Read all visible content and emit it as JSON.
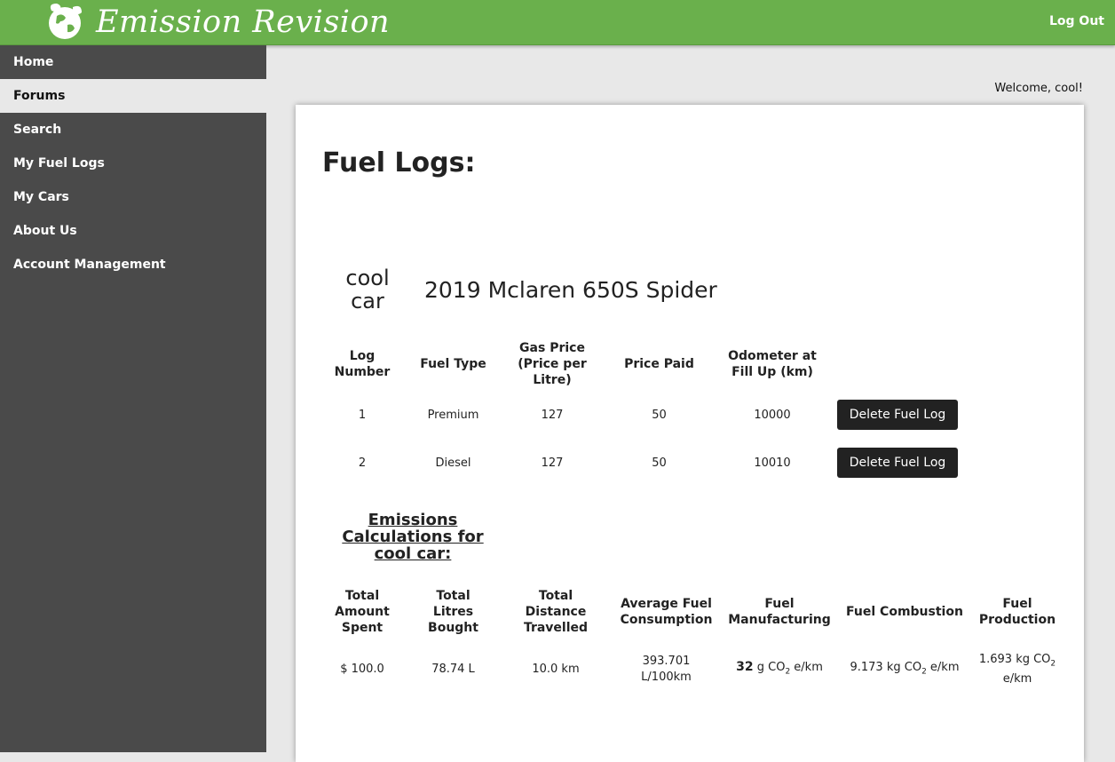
{
  "header": {
    "brand": "Emission Revision",
    "logo_icon": "leaf-globe-icon",
    "logout_label": "Log Out",
    "color": "#6ab04c"
  },
  "sidebar": {
    "items": [
      {
        "label": "Home",
        "active": false
      },
      {
        "label": "Forums",
        "active": true
      },
      {
        "label": "Search",
        "active": false
      },
      {
        "label": "My Fuel Logs",
        "active": false
      },
      {
        "label": "My Cars",
        "active": false
      },
      {
        "label": "About Us",
        "active": false
      },
      {
        "label": "Account Management",
        "active": false
      }
    ]
  },
  "welcome": "Welcome, cool!",
  "main": {
    "title": "Fuel Logs:",
    "car": {
      "nickname": "cool car",
      "name": "2019 Mclaren 650S Spider"
    },
    "logs_table": {
      "headers": [
        "Log Number",
        "Fuel Type",
        "Gas Price (Price per Litre)",
        "Price Paid",
        "Odometer at Fill Up (km)"
      ],
      "rows": [
        {
          "log_number": "1",
          "fuel_type": "Premium",
          "gas_price": "127",
          "price_paid": "50",
          "odometer": "10000",
          "delete_label": "Delete Fuel Log"
        },
        {
          "log_number": "2",
          "fuel_type": "Diesel",
          "gas_price": "127",
          "price_paid": "50",
          "odometer": "10010",
          "delete_label": "Delete Fuel Log"
        }
      ]
    },
    "emissions_heading": "Emissions Calculations for cool car:",
    "calc_table": {
      "headers": [
        "Total Amount Spent",
        "Total Litres Bought",
        "Total Distance Travelled",
        "Average Fuel Consumption",
        "Fuel Manufacturing",
        "Fuel Combustion",
        "Fuel Production"
      ],
      "values": {
        "total_spent": "$ 100.0",
        "total_litres": "78.74 L",
        "total_distance": "10.0 km",
        "avg_consumption": "393.701 L/100km",
        "fuel_manufacturing_value": "32",
        "fuel_manufacturing_unit_pre": "g CO",
        "fuel_manufacturing_unit_sub": "2",
        "fuel_manufacturing_unit_post": " e/km",
        "fuel_combustion_pre": "9.173 kg CO",
        "fuel_combustion_sub": "2",
        "fuel_combustion_post": " e/km",
        "fuel_production_pre": "1.693 kg CO",
        "fuel_production_sub": "2",
        "fuel_production_post": " e/km"
      }
    }
  }
}
